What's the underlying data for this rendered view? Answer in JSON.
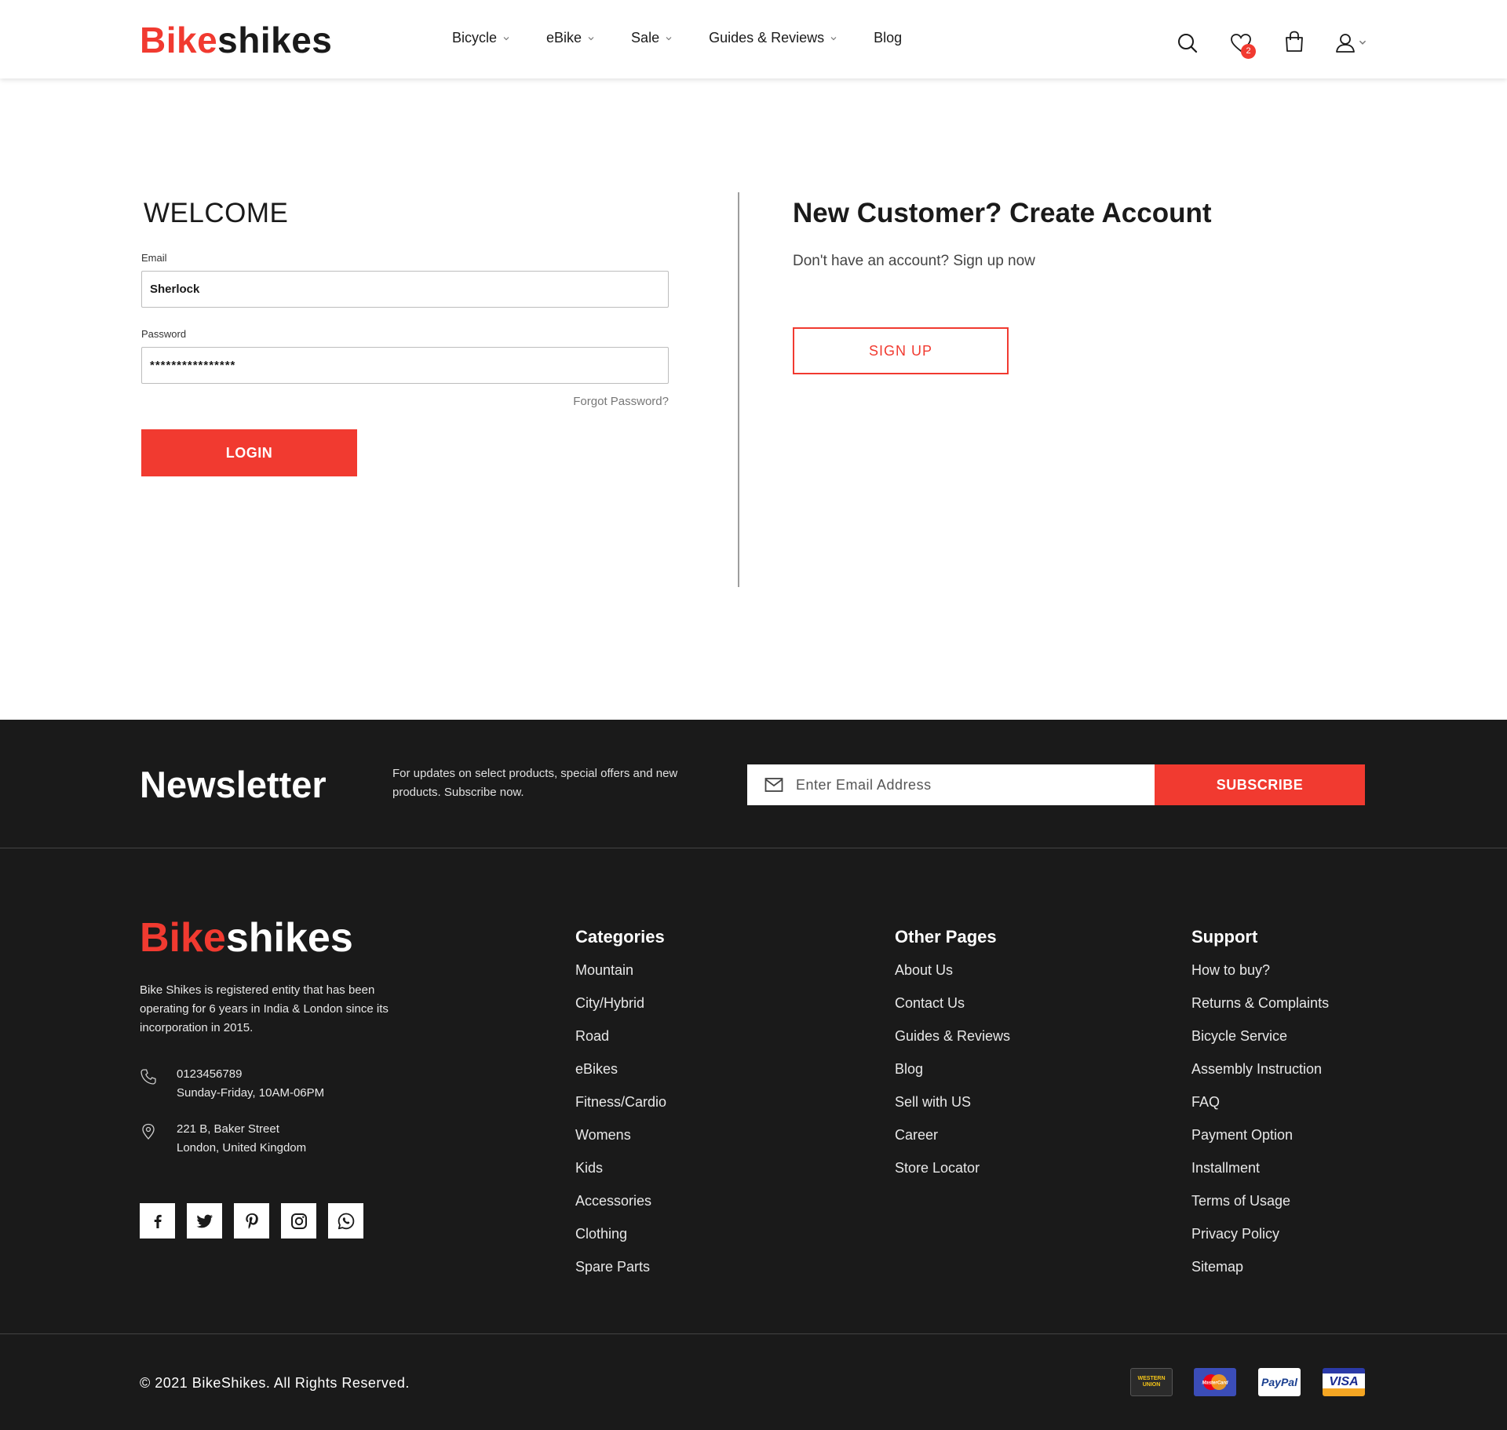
{
  "header": {
    "logo_red": "Bike",
    "logo_dark": "shikes",
    "nav": [
      {
        "label": "Bicycle",
        "has_dropdown": true
      },
      {
        "label": "eBike",
        "has_dropdown": true
      },
      {
        "label": "Sale",
        "has_dropdown": true
      },
      {
        "label": "Guides & Reviews",
        "has_dropdown": true
      },
      {
        "label": "Blog",
        "has_dropdown": false
      }
    ],
    "wishlist_count": "2",
    "icons": [
      "search-icon",
      "heart-icon",
      "bag-icon",
      "user-icon"
    ]
  },
  "login": {
    "title": "WELCOME",
    "email_label": "Email",
    "email_value": "Sherlock",
    "password_label": "Password",
    "password_value": "****************",
    "forgot": "Forgot Password?",
    "login_button": "LOGIN"
  },
  "signup": {
    "title": "New Customer? Create Account",
    "subtitle": "Don't have an account? Sign up now",
    "button": "SIGN UP"
  },
  "newsletter": {
    "title": "Newsletter",
    "text": "For updates on select products, special offers and new products. Subscribe now.",
    "placeholder": "Enter Email Address",
    "button": "SUBSCRIBE"
  },
  "footer": {
    "logo_red": "Bike",
    "logo_white": "shikes",
    "about": "Bike Shikes is registered entity that has been operating for 6 years in India & London since its incorporation  in 2015.",
    "phone": "0123456789",
    "hours": "Sunday-Friday, 10AM-06PM",
    "address_line1": "221 B, Baker Street",
    "address_line2": "London, United Kingdom",
    "socials": [
      "facebook-icon",
      "twitter-icon",
      "pinterest-icon",
      "instagram-icon",
      "whatsapp-icon"
    ],
    "categories": {
      "title": "Categories",
      "links": [
        "Mountain",
        "City/Hybrid",
        "Road",
        "eBikes",
        "Fitness/Cardio",
        "Womens",
        "Kids",
        "Accessories",
        "Clothing",
        "Spare Parts"
      ]
    },
    "other_pages": {
      "title": "Other Pages",
      "links": [
        "About Us",
        "Contact Us",
        "Guides & Reviews",
        "Blog",
        "Sell with US",
        "Career",
        "Store Locator"
      ]
    },
    "support": {
      "title": "Support",
      "links": [
        "How to buy?",
        "Returns & Complaints",
        "Bicycle Service",
        "Assembly Instruction",
        "FAQ",
        "Payment Option",
        "Installment",
        "Terms of Usage",
        "Privacy Policy",
        "Sitemap"
      ]
    },
    "copyright": "© 2021 BikeShikes.  All Rights Reserved.",
    "payments": [
      "WESTERN UNION",
      "MasterCard",
      "PayPal",
      "VISA"
    ]
  },
  "colors": {
    "accent": "#f13a30",
    "footer_bg": "#1a1a1a",
    "text": "#1a1a1a"
  }
}
